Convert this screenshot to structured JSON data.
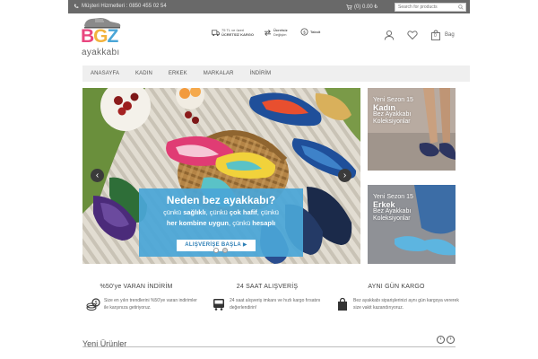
{
  "topbar": {
    "customer_service": "Müşteri Hizmetleri : 0850 455 02 54",
    "cart": "(0) 0.00 ₺",
    "search_placeholder": "Search for products"
  },
  "logo": {
    "letters": [
      "B",
      "G",
      "Z"
    ],
    "letter_colors": [
      "#e9467f",
      "#f2b33d",
      "#4aa6d7"
    ],
    "subtitle": "ayakkabı"
  },
  "header_features": [
    {
      "icon": "truck-icon",
      "line1": "75 TL ve üzeri",
      "line2": "ÜCRETSİZ KARGO"
    },
    {
      "icon": "exchange-icon",
      "line1": "Ücretsiz",
      "line2": "Değişim"
    },
    {
      "icon": "installment-icon",
      "line1": "Taksit",
      "line2": ""
    }
  ],
  "header_icons": {
    "bag_count": "0",
    "bag_label": "Bag"
  },
  "nav": [
    "ANASAYFA",
    "KADIN",
    "ERKEK",
    "MARKALAR",
    "İNDİRİM"
  ],
  "slider": {
    "headline": "Neden bez ayakkabı?",
    "line1": [
      {
        "text": "çünkü ",
        "bold": false
      },
      {
        "text": "sağlıklı",
        "bold": true
      },
      {
        "text": ", çünkü ",
        "bold": false
      },
      {
        "text": "çok hafif",
        "bold": true
      },
      {
        "text": ", çünkü",
        "bold": false
      }
    ],
    "line2": [
      {
        "text": "her kombine uygun",
        "bold": true
      },
      {
        "text": ", çünkü ",
        "bold": false
      },
      {
        "text": "hesaplı",
        "bold": true
      }
    ],
    "cta": "ALIŞVERİŞE BAŞLA",
    "prev": "‹",
    "next": "›"
  },
  "banners": [
    {
      "line1": "Yeni Sezon 15",
      "line2": "Kadın",
      "line3": "Bez Ayakkabı",
      "line4": "Koleksiyonlar"
    },
    {
      "line1": "Yeni Sezon 15",
      "line2": "Erkek",
      "line3": "Bez Ayakkabı",
      "line4": "Koleksiyonlar"
    }
  ],
  "info": [
    {
      "title": "%50'ye VARAN İNDİRİM",
      "icon": "coins-icon",
      "text": "Size en yılın trendlerini %50'ye varan indirimler ile karşınıza getiriyoruz."
    },
    {
      "title": "24 SAAT ALIŞVERİŞ",
      "icon": "bus-icon",
      "text": "24 saat alışveriş imkanı ve hızlı kargo fırsatını değerlendirin!"
    },
    {
      "title": "AYNI GÜN KARGO",
      "icon": "shopping-bag-icon",
      "text": "Bez ayakkabı siparişlerinizi aynı gün kargoya vererek size vakit kazandırıyoruz."
    }
  ],
  "new_products": {
    "title": "Yeni Ürünler",
    "prev": "‹",
    "next": "›"
  }
}
